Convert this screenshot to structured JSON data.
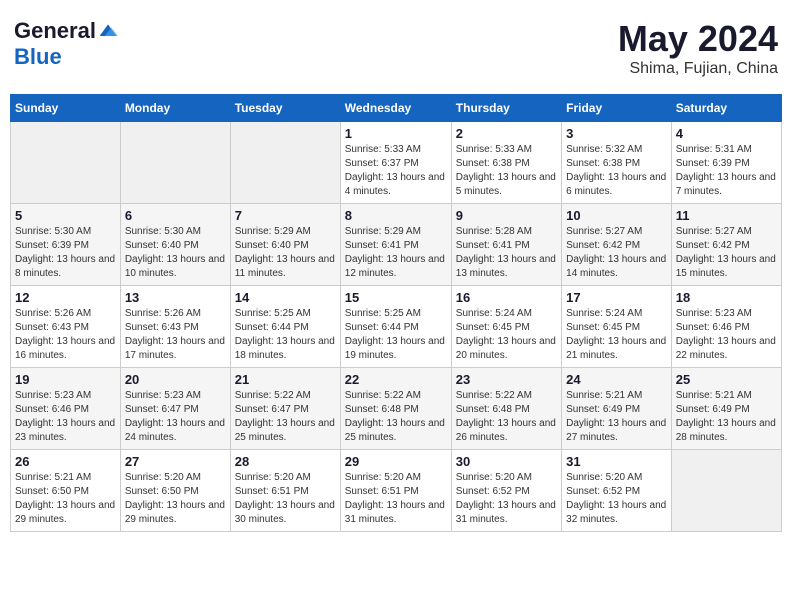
{
  "logo": {
    "general": "General",
    "blue": "Blue"
  },
  "header": {
    "month": "May 2024",
    "location": "Shima, Fujian, China"
  },
  "weekdays": [
    "Sunday",
    "Monday",
    "Tuesday",
    "Wednesday",
    "Thursday",
    "Friday",
    "Saturday"
  ],
  "weeks": [
    [
      {
        "day": "",
        "info": ""
      },
      {
        "day": "",
        "info": ""
      },
      {
        "day": "",
        "info": ""
      },
      {
        "day": "1",
        "info": "Sunrise: 5:33 AM\nSunset: 6:37 PM\nDaylight: 13 hours and 4 minutes."
      },
      {
        "day": "2",
        "info": "Sunrise: 5:33 AM\nSunset: 6:38 PM\nDaylight: 13 hours and 5 minutes."
      },
      {
        "day": "3",
        "info": "Sunrise: 5:32 AM\nSunset: 6:38 PM\nDaylight: 13 hours and 6 minutes."
      },
      {
        "day": "4",
        "info": "Sunrise: 5:31 AM\nSunset: 6:39 PM\nDaylight: 13 hours and 7 minutes."
      }
    ],
    [
      {
        "day": "5",
        "info": "Sunrise: 5:30 AM\nSunset: 6:39 PM\nDaylight: 13 hours and 8 minutes."
      },
      {
        "day": "6",
        "info": "Sunrise: 5:30 AM\nSunset: 6:40 PM\nDaylight: 13 hours and 10 minutes."
      },
      {
        "day": "7",
        "info": "Sunrise: 5:29 AM\nSunset: 6:40 PM\nDaylight: 13 hours and 11 minutes."
      },
      {
        "day": "8",
        "info": "Sunrise: 5:29 AM\nSunset: 6:41 PM\nDaylight: 13 hours and 12 minutes."
      },
      {
        "day": "9",
        "info": "Sunrise: 5:28 AM\nSunset: 6:41 PM\nDaylight: 13 hours and 13 minutes."
      },
      {
        "day": "10",
        "info": "Sunrise: 5:27 AM\nSunset: 6:42 PM\nDaylight: 13 hours and 14 minutes."
      },
      {
        "day": "11",
        "info": "Sunrise: 5:27 AM\nSunset: 6:42 PM\nDaylight: 13 hours and 15 minutes."
      }
    ],
    [
      {
        "day": "12",
        "info": "Sunrise: 5:26 AM\nSunset: 6:43 PM\nDaylight: 13 hours and 16 minutes."
      },
      {
        "day": "13",
        "info": "Sunrise: 5:26 AM\nSunset: 6:43 PM\nDaylight: 13 hours and 17 minutes."
      },
      {
        "day": "14",
        "info": "Sunrise: 5:25 AM\nSunset: 6:44 PM\nDaylight: 13 hours and 18 minutes."
      },
      {
        "day": "15",
        "info": "Sunrise: 5:25 AM\nSunset: 6:44 PM\nDaylight: 13 hours and 19 minutes."
      },
      {
        "day": "16",
        "info": "Sunrise: 5:24 AM\nSunset: 6:45 PM\nDaylight: 13 hours and 20 minutes."
      },
      {
        "day": "17",
        "info": "Sunrise: 5:24 AM\nSunset: 6:45 PM\nDaylight: 13 hours and 21 minutes."
      },
      {
        "day": "18",
        "info": "Sunrise: 5:23 AM\nSunset: 6:46 PM\nDaylight: 13 hours and 22 minutes."
      }
    ],
    [
      {
        "day": "19",
        "info": "Sunrise: 5:23 AM\nSunset: 6:46 PM\nDaylight: 13 hours and 23 minutes."
      },
      {
        "day": "20",
        "info": "Sunrise: 5:23 AM\nSunset: 6:47 PM\nDaylight: 13 hours and 24 minutes."
      },
      {
        "day": "21",
        "info": "Sunrise: 5:22 AM\nSunset: 6:47 PM\nDaylight: 13 hours and 25 minutes."
      },
      {
        "day": "22",
        "info": "Sunrise: 5:22 AM\nSunset: 6:48 PM\nDaylight: 13 hours and 25 minutes."
      },
      {
        "day": "23",
        "info": "Sunrise: 5:22 AM\nSunset: 6:48 PM\nDaylight: 13 hours and 26 minutes."
      },
      {
        "day": "24",
        "info": "Sunrise: 5:21 AM\nSunset: 6:49 PM\nDaylight: 13 hours and 27 minutes."
      },
      {
        "day": "25",
        "info": "Sunrise: 5:21 AM\nSunset: 6:49 PM\nDaylight: 13 hours and 28 minutes."
      }
    ],
    [
      {
        "day": "26",
        "info": "Sunrise: 5:21 AM\nSunset: 6:50 PM\nDaylight: 13 hours and 29 minutes."
      },
      {
        "day": "27",
        "info": "Sunrise: 5:20 AM\nSunset: 6:50 PM\nDaylight: 13 hours and 29 minutes."
      },
      {
        "day": "28",
        "info": "Sunrise: 5:20 AM\nSunset: 6:51 PM\nDaylight: 13 hours and 30 minutes."
      },
      {
        "day": "29",
        "info": "Sunrise: 5:20 AM\nSunset: 6:51 PM\nDaylight: 13 hours and 31 minutes."
      },
      {
        "day": "30",
        "info": "Sunrise: 5:20 AM\nSunset: 6:52 PM\nDaylight: 13 hours and 31 minutes."
      },
      {
        "day": "31",
        "info": "Sunrise: 5:20 AM\nSunset: 6:52 PM\nDaylight: 13 hours and 32 minutes."
      },
      {
        "day": "",
        "info": ""
      }
    ]
  ]
}
